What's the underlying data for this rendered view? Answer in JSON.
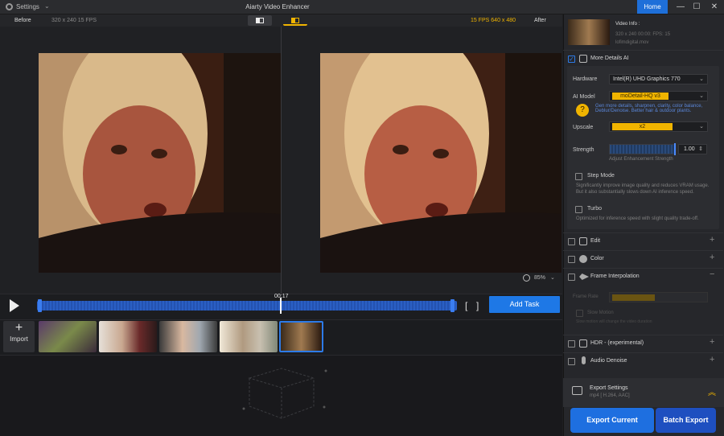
{
  "titlebar": {
    "settings": "Settings",
    "title": "Aiarty Video Enhancer",
    "home": "Home",
    "minimize": "—",
    "maximize": "☐",
    "close": "✕"
  },
  "preview": {
    "before": "Before",
    "after": "After",
    "before_info": "320 x 240  15 FPS",
    "after_info": "15 FPS  640 x 480",
    "zoom": "85%",
    "time": "00:17"
  },
  "timeline": {
    "add_task": "Add Task",
    "bracket_open": "[",
    "bracket_close": "]"
  },
  "thumbs": {
    "import_label": "Import",
    "import_plus": "+"
  },
  "video_info": {
    "title": "Video Info :",
    "spec": "320 x 240  00:00:  FPS: 15",
    "file": "lofimdigital.mov"
  },
  "more_details": {
    "label": "More Details AI",
    "checked": true
  },
  "hardware": {
    "label": "Hardware",
    "value": "Intel(R) UHD Graphics 770"
  },
  "ai_model": {
    "label": "AI Model",
    "value": "moDetail-HQ  v3",
    "desc": "Gen more details, sharpnen, clarity, color balance, Deblur/Denoise. Better hair & outdoor plants."
  },
  "upscale": {
    "label": "Upscale",
    "value": "x2"
  },
  "strength": {
    "label": "Strength",
    "value": "1.00",
    "sub": "Adjust Enhancement Strength"
  },
  "step_mode": {
    "label": "Step Mode",
    "desc1": "Significantly improve image quality and reduces VRAM usage.",
    "desc2": "But it also substantially slows down AI inference speed."
  },
  "turbo": {
    "label": "Turbo",
    "desc": "Optimized for inference speed with slight quality trade-off."
  },
  "sections": {
    "edit": "Edit",
    "color": "Color",
    "frame_interp": "Frame Interpolation",
    "frame_rate": "Frame Rate",
    "slow_motion": "Slow Motion",
    "slow_desc": "Slow motion will change the video duration",
    "hdr": "HDR - (experimental)",
    "audio": "Audio Denoise"
  },
  "export": {
    "title": "Export Settings",
    "format": "mp4 [ H.264, AAC]",
    "current": "Export Current",
    "batch": "Batch Export"
  }
}
